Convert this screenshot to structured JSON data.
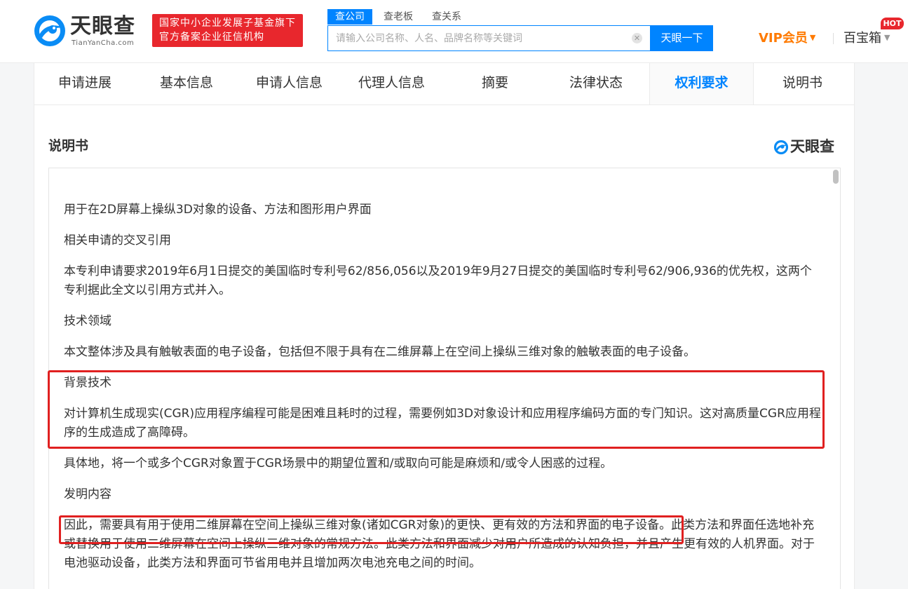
{
  "header": {
    "logo_cn": "天眼查",
    "logo_en": "TianYanCha.com",
    "gov_badge": [
      "国家中小企业发展子基金旗下",
      "官方备案企业征信机构"
    ],
    "search_tabs": [
      "查公司",
      "查老板",
      "查关系"
    ],
    "search_placeholder": "请输入公司名称、人名、品牌名称等关键词",
    "search_button": "天眼一下",
    "vip_label": "VIP会员",
    "baibox_label": "百宝箱",
    "hot_badge": "HOT",
    "colors": {
      "brand_blue": "#0084ff",
      "badge_red": "#e8272d",
      "vip_orange": "#ff7a00"
    }
  },
  "tabs": [
    {
      "label": "申请进展",
      "active": false
    },
    {
      "label": "基本信息",
      "active": false
    },
    {
      "label": "申请人信息",
      "active": false
    },
    {
      "label": "代理人信息",
      "active": false
    },
    {
      "label": "摘要",
      "active": false
    },
    {
      "label": "法律状态",
      "active": false
    },
    {
      "label": "权利要求",
      "active": true
    },
    {
      "label": "说明书",
      "active": false
    }
  ],
  "section": {
    "title": "说明书",
    "brand": "天眼查"
  },
  "document": {
    "paragraphs": [
      "用于在2D屏幕上操纵3D对象的设备、方法和图形用户界面",
      "相关申请的交叉引用",
      "本专利申请要求2019年6月1日提交的美国临时专利号62/856,056以及2019年9月27日提交的美国临时专利号62/906,936的优先权，这两个专利据此全文以引用方式并入。",
      "技术领域",
      "本文整体涉及具有触敏表面的电子设备，包括但不限于具有在二维屏幕上在空间上操纵三维对象的触敏表面的电子设备。",
      "背景技术",
      "对计算机生成现实(CGR)应用程序编程可能是困难且耗时的过程，需要例如3D对象设计和应用程序编码方面的专门知识。这对高质量CGR应用程序的生成造成了高障碍。",
      "具体地，将一个或多个CGR对象置于CGR场景中的期望位置和/或取向可能是麻烦和/或令人困惑的过程。",
      "发明内容",
      "因此，需要具有用于使用二维屏幕在空间上操纵三维对象(诸如CGR对象)的更快、更有效的方法和界面的电子设备。此类方法和界面任选地补充或替换用于使用二维屏幕在空间上操纵三维对象的常规方法。此类方法和界面减少对用户所造成的认知负担，并且产生更有效的人机界面。对于电池驱动设备，此类方法和界面可节省用电并且增加两次电池充电之间的时间。"
    ]
  },
  "annotations": {
    "highlight_color": "#e02020"
  }
}
